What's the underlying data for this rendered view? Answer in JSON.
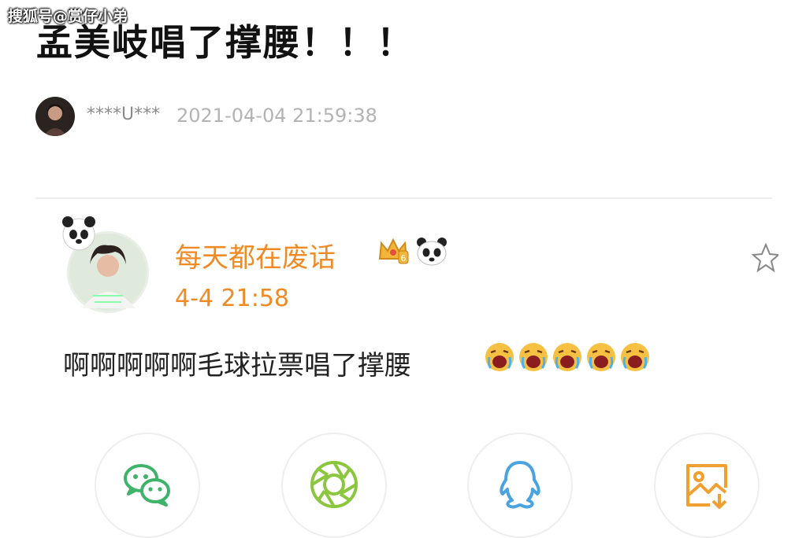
{
  "watermark": "搜狐号@赏仔小弟",
  "title": "孟美岐唱了撑腰！！！",
  "post": {
    "author": "****U***",
    "time": "2021-04-04 21:59:38"
  },
  "comment": {
    "username": "每天都在废话",
    "time": "4-4 21:58",
    "text": "啊啊啊啊啊毛球拉票唱了撑腰",
    "emoji_count": 5
  },
  "share_actions": [
    {
      "name": "wechat",
      "icon": "wechat-icon"
    },
    {
      "name": "moments",
      "icon": "moments-icon"
    },
    {
      "name": "qq",
      "icon": "qq-icon"
    },
    {
      "name": "save-image",
      "icon": "save-image-icon"
    }
  ],
  "colors": {
    "username": "#f08a24",
    "wechat": "#3fb36a",
    "moments": "#8cc63f",
    "qq": "#4aa3df",
    "save": "#f0a030"
  }
}
